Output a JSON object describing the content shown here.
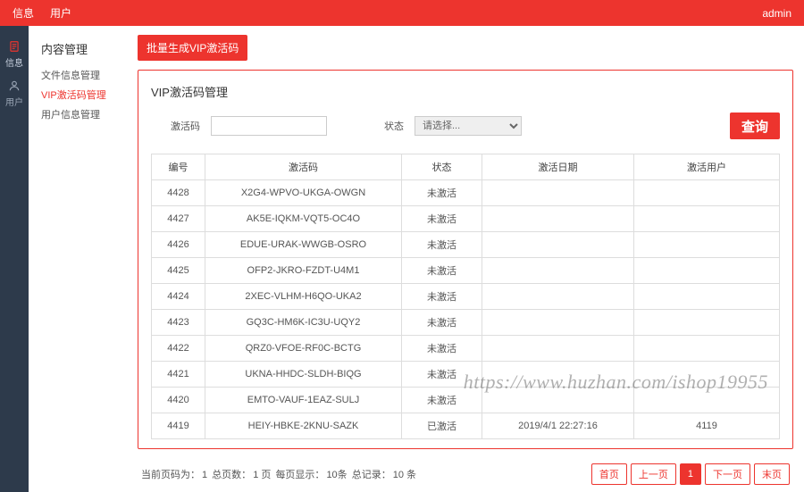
{
  "topbar": {
    "tabs": [
      "信息",
      "用户"
    ],
    "user": "admin"
  },
  "rail": [
    {
      "icon": "doc",
      "label": "信息"
    },
    {
      "icon": "user",
      "label": "用户"
    }
  ],
  "subnav": {
    "title": "内容管理",
    "items": [
      {
        "label": "文件信息管理",
        "active": false
      },
      {
        "label": "VIP激活码管理",
        "active": true
      },
      {
        "label": "用户信息管理",
        "active": false
      }
    ]
  },
  "actions": {
    "generate": "批量生成VIP激活码",
    "search": "查询"
  },
  "panel": {
    "title": "VIP激活码管理"
  },
  "filters": {
    "code_label": "激活码",
    "code_value": "",
    "status_label": "状态",
    "status_placeholder": "请选择..."
  },
  "table": {
    "headers": {
      "id": "编号",
      "code": "激活码",
      "status": "状态",
      "date": "激活日期",
      "user": "激活用户"
    },
    "rows": [
      {
        "id": "4428",
        "code": "X2G4-WPVO-UKGA-OWGN",
        "status": "未激活",
        "date": "",
        "user": ""
      },
      {
        "id": "4427",
        "code": "AK5E-IQKM-VQT5-OC4O",
        "status": "未激活",
        "date": "",
        "user": ""
      },
      {
        "id": "4426",
        "code": "EDUE-URAK-WWGB-OSRO",
        "status": "未激活",
        "date": "",
        "user": ""
      },
      {
        "id": "4425",
        "code": "OFP2-JKRO-FZDT-U4M1",
        "status": "未激活",
        "date": "",
        "user": ""
      },
      {
        "id": "4424",
        "code": "2XEC-VLHM-H6QO-UKA2",
        "status": "未激活",
        "date": "",
        "user": ""
      },
      {
        "id": "4423",
        "code": "GQ3C-HM6K-IC3U-UQY2",
        "status": "未激活",
        "date": "",
        "user": ""
      },
      {
        "id": "4422",
        "code": "QRZ0-VFOE-RF0C-BCTG",
        "status": "未激活",
        "date": "",
        "user": ""
      },
      {
        "id": "4421",
        "code": "UKNA-HHDC-SLDH-BIQG",
        "status": "未激活",
        "date": "",
        "user": ""
      },
      {
        "id": "4420",
        "code": "EMTO-VAUF-1EAZ-SULJ",
        "status": "未激活",
        "date": "",
        "user": ""
      },
      {
        "id": "4419",
        "code": "HEIY-HBKE-2KNU-SAZK",
        "status": "已激活",
        "date": "2019/4/1 22:27:16",
        "user": "4119"
      }
    ]
  },
  "pager": {
    "info_prefix": "当前页码为：",
    "cur_page": "1",
    "total_pages_label": "总页数：",
    "total_pages": "1 页",
    "per_page_label": "每页显示：",
    "per_page": "10条",
    "total_records_label": "总记录：",
    "total_records": "10 条",
    "first": "首页",
    "prev": "上一页",
    "page1": "1",
    "next": "下一页",
    "last": "末页"
  },
  "watermark": "https://www.huzhan.com/ishop19955"
}
